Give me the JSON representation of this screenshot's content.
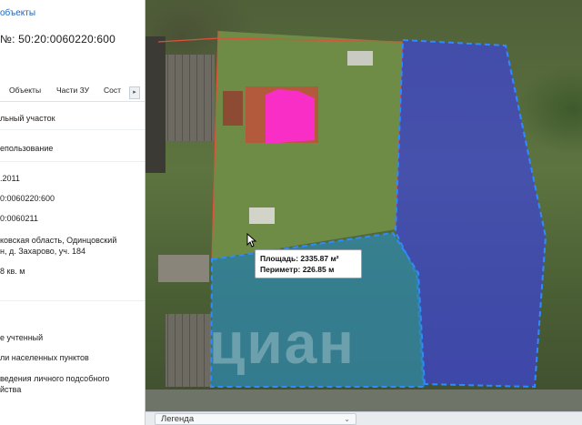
{
  "panel": {
    "back_link": "объекты",
    "cadastral_title": "№: 50:20:0060220:600",
    "tabs": [
      {
        "label": "Объекты"
      },
      {
        "label": "Части ЗУ"
      },
      {
        "label": "Сост"
      }
    ],
    "tab_scroll_label": "▸",
    "rows": [
      "льный участок",
      "епользование",
      ".2011",
      "0:0060220:600",
      "0:0060211",
      "ковская область, Одинцовский",
      "н, д. Захарово, уч. 184",
      "8 кв. м",
      "е учтенный",
      "ли населенных пунктов",
      "ведения личного подсобного",
      "йства"
    ]
  },
  "map": {
    "tooltip": {
      "area": "Площадь: 2335.87 м²",
      "perimeter": "Периметр: 226.85 м"
    },
    "legend_label": "Легенда",
    "legend_chevron": "⌄",
    "watermark": "циан",
    "colors": {
      "blue_parcel": "#3d44d6",
      "teal_parcel": "#2f86a8",
      "building_highlight": "#ff2ad4",
      "dashed_outline": "#2e8bff",
      "red_boundary": "#e0503a"
    },
    "icons": [
      "cursor-arrow-icon",
      "chevron-down-icon",
      "chevron-right-icon"
    ]
  }
}
